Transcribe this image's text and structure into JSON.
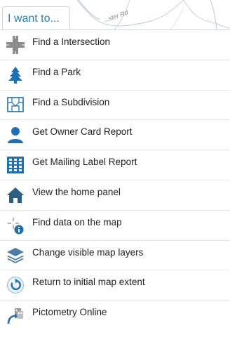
{
  "map": {
    "road_label": "...ster Rd"
  },
  "panel": {
    "tab_label": "I want to..."
  },
  "menu": {
    "items": [
      {
        "label": "Find a Intersection",
        "icon": "intersection-icon"
      },
      {
        "label": "Find a Park",
        "icon": "tree-icon"
      },
      {
        "label": "Find a Subdivision",
        "icon": "subdivision-icon"
      },
      {
        "label": "Get Owner Card Report",
        "icon": "person-icon"
      },
      {
        "label": "Get Mailing Label Report",
        "icon": "mailing-label-grid-icon"
      },
      {
        "label": "View the home panel",
        "icon": "home-icon"
      },
      {
        "label": "Find data on the map",
        "icon": "crosshair-info-icon"
      },
      {
        "label": "Change visible map layers",
        "icon": "layers-icon"
      },
      {
        "label": "Return to initial map extent",
        "icon": "return-extent-icon"
      },
      {
        "label": "Pictometry Online",
        "icon": "pictometry-icon"
      }
    ]
  },
  "colors": {
    "accent_blue": "#2a7fc1",
    "icon_blue": "#1f6fb5",
    "text": "#222222",
    "divider": "#e6e6e6"
  }
}
